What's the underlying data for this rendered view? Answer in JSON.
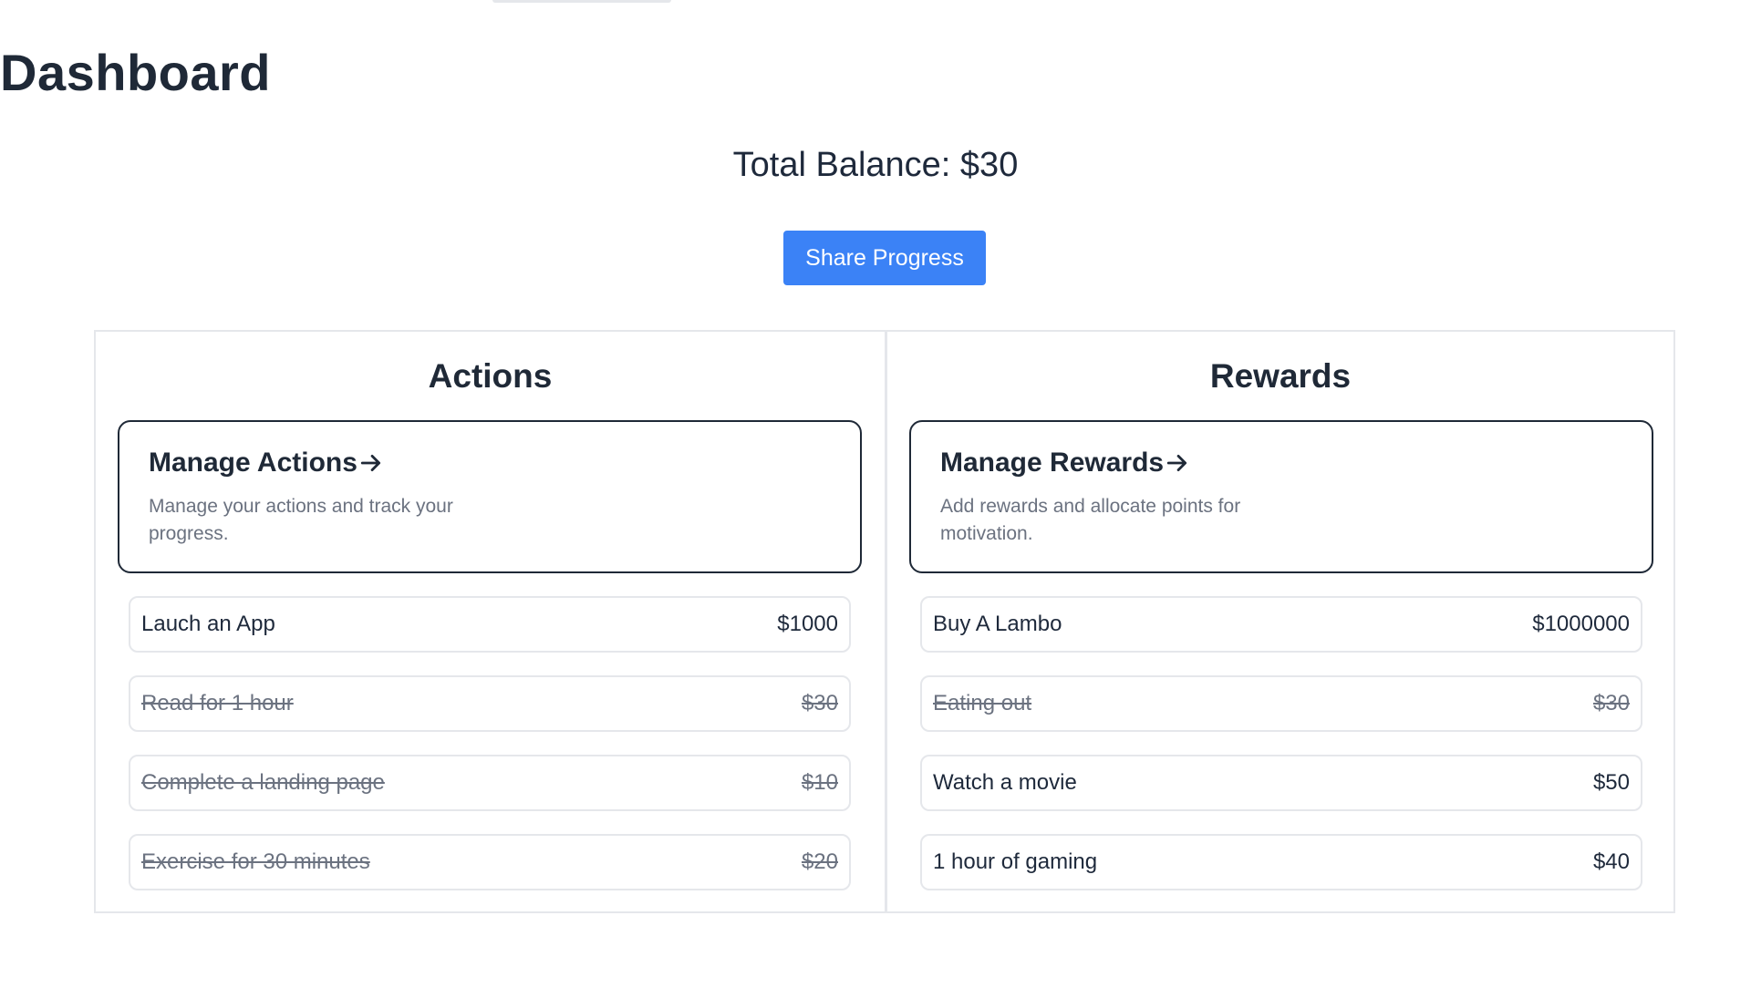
{
  "header": {
    "title": "Dashboard",
    "balance": "Total Balance: $30",
    "share_label": "Share Progress"
  },
  "colors": {
    "primary": "#3b82f6",
    "text": "#1f2937",
    "muted": "#6b7280",
    "border": "#e5e7eb"
  },
  "actions": {
    "title": "Actions",
    "manage": {
      "title": "Manage Actions",
      "description": "Manage your actions and track your progress.",
      "icon": "arrow-right-icon"
    },
    "items": [
      {
        "name": "Lauch an App",
        "value": "$1000",
        "done": false
      },
      {
        "name": "Read for 1 hour",
        "value": "$30",
        "done": true
      },
      {
        "name": "Complete a landing page",
        "value": "$10",
        "done": true
      },
      {
        "name": "Exercise for 30 minutes",
        "value": "$20",
        "done": true
      }
    ]
  },
  "rewards": {
    "title": "Rewards",
    "manage": {
      "title": "Manage Rewards",
      "description": "Add rewards and allocate points for motivation.",
      "icon": "arrow-right-icon"
    },
    "items": [
      {
        "name": "Buy A Lambo",
        "value": "$1000000",
        "done": false
      },
      {
        "name": "Eating out",
        "value": "$30",
        "done": true
      },
      {
        "name": "Watch a movie",
        "value": "$50",
        "done": false
      },
      {
        "name": "1 hour of gaming",
        "value": "$40",
        "done": false
      }
    ]
  }
}
